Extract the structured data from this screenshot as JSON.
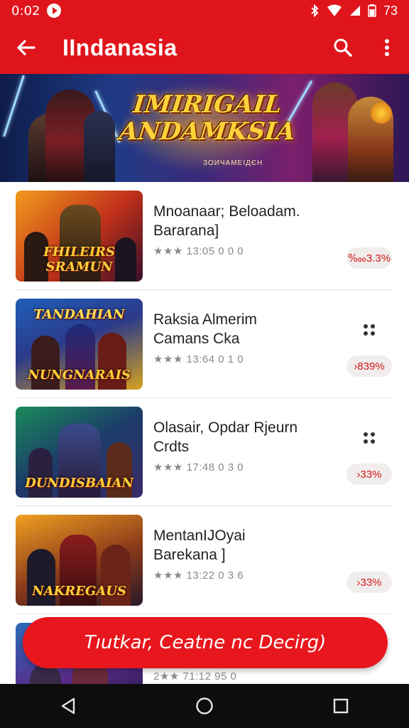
{
  "status_bar": {
    "time": "0:02",
    "battery": "73"
  },
  "app_bar": {
    "title": "IIndanasia"
  },
  "banner": {
    "title_line1": "IMIRIGAIL",
    "title_line2": "ANDAMKSIA",
    "subtitle": "ЗОИЧАМЕІДЄН"
  },
  "games": [
    {
      "title_line1": "Mnoanaar; Beloadam.",
      "title_line2": "Bararana]",
      "meta": "★★★ 13:05 0 0 0",
      "badge": "‱3.3%",
      "thumb_caption": "FHILEIRS SRAMUN",
      "has_menu": false
    },
    {
      "title_line1": "Raksia Almerim",
      "title_line2": "Camans Cka",
      "meta": "★★★ 13:64 0 1 0",
      "badge": "›839%",
      "thumb_caption": "NUNGNARAIS",
      "thumb_caption_top": "TANDAHIAN",
      "has_menu": true
    },
    {
      "title_line1": "Olasair, Opdar Rjeurn",
      "title_line2": "Crdts",
      "meta": "★★★ 17:48 0 3 0",
      "badge": "›33%",
      "thumb_caption": "DUNDISBAIAN",
      "has_menu": true
    },
    {
      "title_line1": "MentanIJOyai",
      "title_line2": "Barekana ]",
      "meta": "★★★ 13:22 0 3 6",
      "badge": "›33%",
      "thumb_caption": "NAKREGAUS",
      "has_menu": false
    },
    {
      "title_line1": "",
      "title_line2": "",
      "meta": "2★★ 71:12 95 0",
      "badge": "",
      "thumb_caption": "",
      "has_menu": false
    }
  ],
  "cta": {
    "label": "Tıutkar, Ceatne nc Decirg)"
  },
  "colors": {
    "accent": "#e0141b",
    "badge_text": "#d31818",
    "badge_bg": "#f1eded"
  }
}
